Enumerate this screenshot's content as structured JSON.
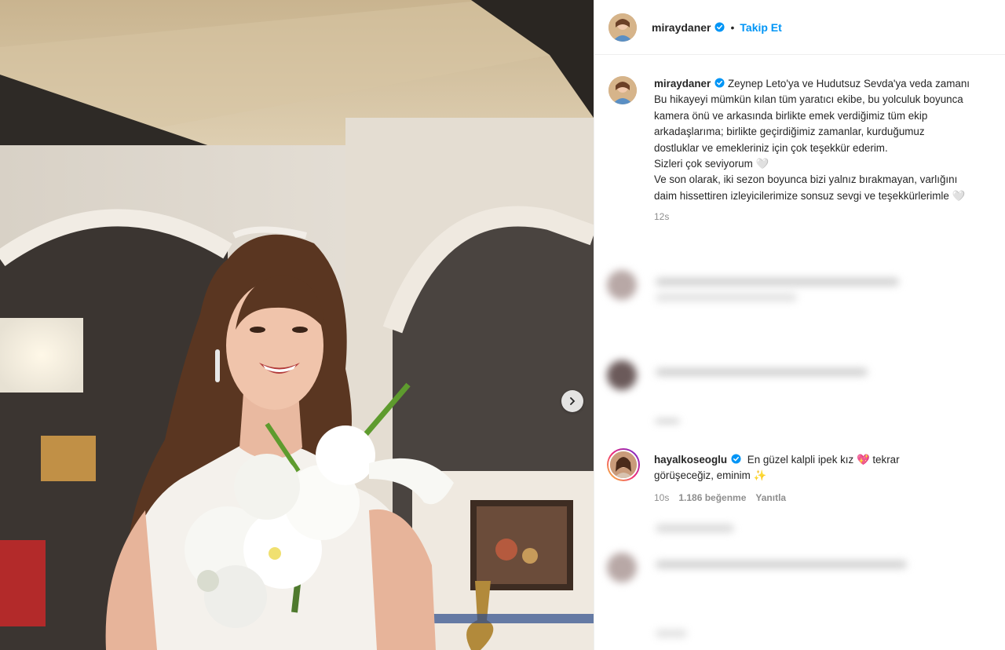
{
  "post": {
    "author": "miraydaner",
    "follow_label": "Takip Et",
    "separator": "•",
    "next_arrow": "chevron-right-icon"
  },
  "caption": {
    "username": "miraydaner",
    "lines": [
      "Zeynep Leto'ya ve Hudutsuz Sevda'ya veda zamanı",
      "Bu hikayeyi mümkün kılan tüm yaratıcı ekibe, bu yolculuk boyunca",
      "kamera önü ve arkasında birlikte emek verdiğimiz tüm ekip",
      "arkadaşlarıma; birlikte geçirdiğimiz zamanlar, kurduğumuz",
      "dostluklar ve emekleriniz için çok teşekkür ederim.",
      "Sizleri çok seviyorum 🤍",
      "Ve son olarak, iki sezon boyunca bizi yalnız bırakmayan, varlığını",
      "daim hissettiren izleyicilerimize sonsuz sevgi ve teşekkürlerimle 🤍"
    ],
    "time": "12s"
  },
  "comment": {
    "username": "hayalkoseoglu",
    "text_line1": "En güzel kalpli ipek kız 💖 tekrar",
    "text_line2": "görüşeceğiz, eminim ✨",
    "time": "10s",
    "likes": "1.186 beğenme",
    "reply": "Yanıtla"
  },
  "colors": {
    "accent": "#0095f6",
    "verified": "#0095f6",
    "secondary_text": "#8e8e8e"
  }
}
